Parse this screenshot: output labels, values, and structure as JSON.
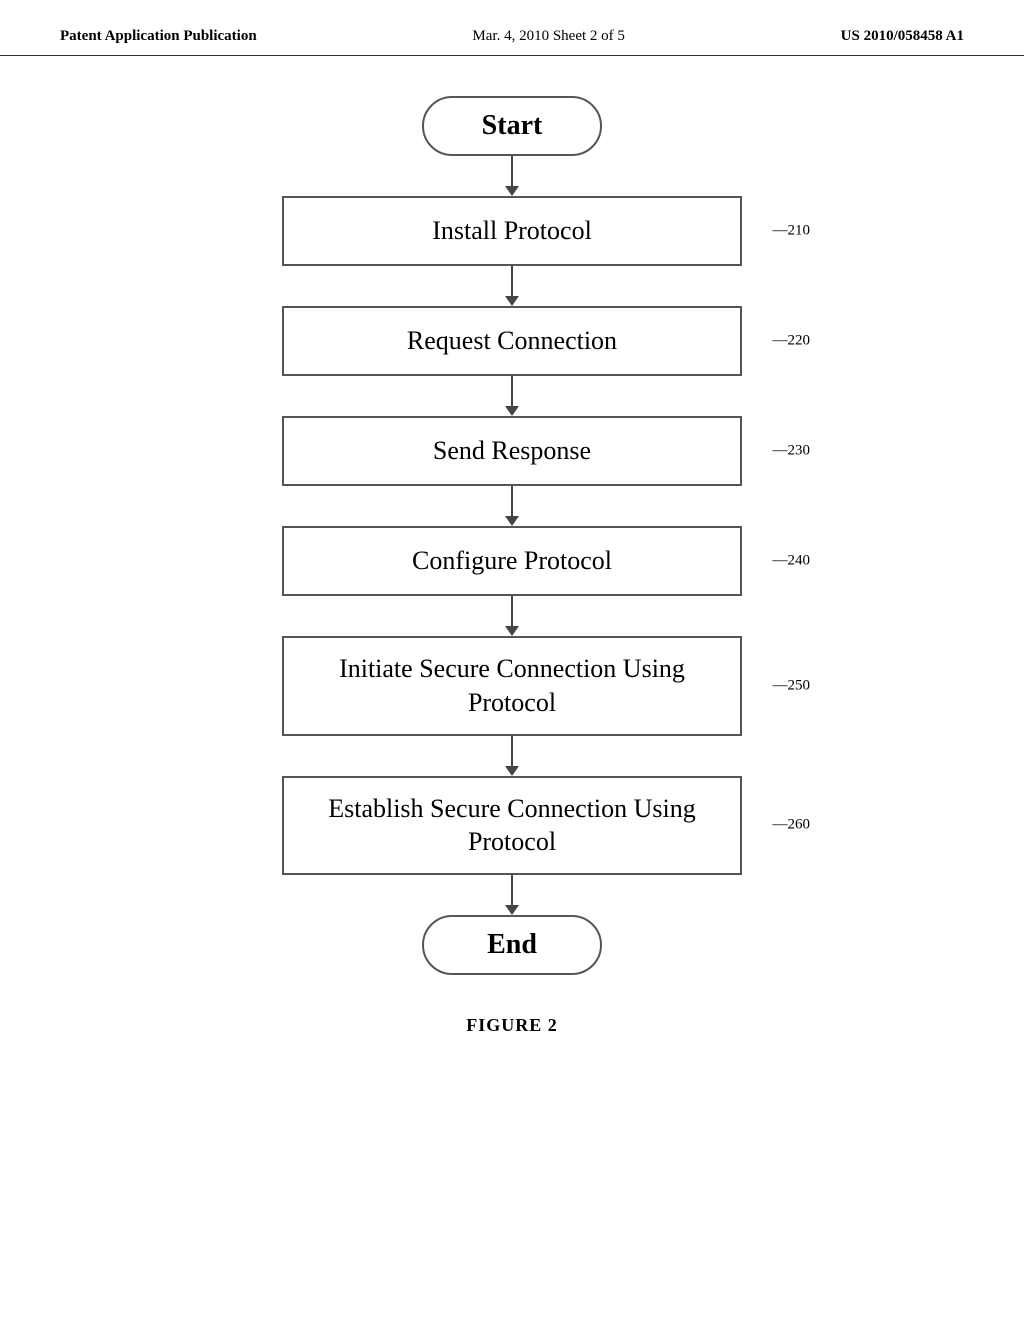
{
  "header": {
    "left_label": "Patent Application Publication",
    "center_label": "Mar. 4, 2010   Sheet 2 of 5",
    "right_label": "US 2010/058458 A1"
  },
  "flowchart": {
    "start_label": "Start",
    "end_label": "End",
    "steps": [
      {
        "id": "210",
        "label": "Install Protocol",
        "multiline": false
      },
      {
        "id": "220",
        "label": "Request Connection",
        "multiline": false
      },
      {
        "id": "230",
        "label": "Send Response",
        "multiline": false
      },
      {
        "id": "240",
        "label": "Configure Protocol",
        "multiline": false
      },
      {
        "id": "250",
        "label": "Initiate Secure Connection Using Protocol",
        "multiline": true
      },
      {
        "id": "260",
        "label": "Establish Secure Connection Using Protocol",
        "multiline": true
      }
    ]
  },
  "figure": {
    "caption": "FIGURE 2"
  }
}
